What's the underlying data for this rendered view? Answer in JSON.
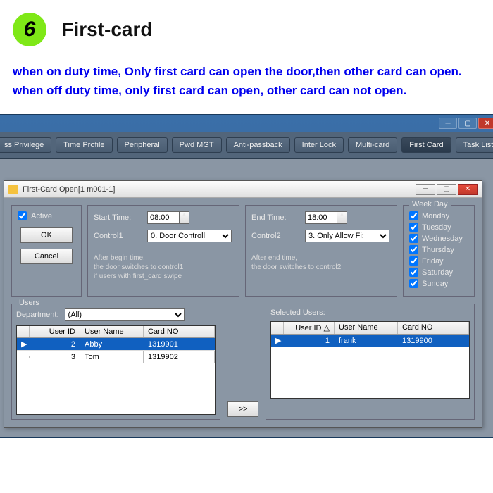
{
  "header": {
    "num": "6",
    "title": "First-card"
  },
  "desc": {
    "line1": "when on duty time, Only first card can open the door,then other card can open.",
    "line2": "when off duty time, only first card can open, other card can not open."
  },
  "tabs": [
    "ss Privilege",
    "Time Profile",
    "Peripheral",
    "Pwd MGT",
    "Anti-passback",
    "Inter Lock",
    "Multi-card",
    "First Card",
    "Task List"
  ],
  "tabs_active_index": 7,
  "dialog": {
    "title": "First-Card Open[1   m001-1]",
    "active_label": "Active",
    "ok": "OK",
    "cancel": "Cancel",
    "start_label": "Start Time:",
    "start_value": "08:00",
    "control1_label": "Control1",
    "control1_value": "0. Door Controll",
    "hint1a": "After begin time,",
    "hint1b": "the door switches to control1",
    "hint1c": "if users with first_card  swipe",
    "end_label": "End Time:",
    "end_value": "18:00",
    "control2_label": "Control2",
    "control2_value": "3. Only Allow Fi:",
    "hint2a": "After end time,",
    "hint2b": "the door switches to control2",
    "week_legend": "Week Day",
    "weekdays": [
      "Monday",
      "Tuesday",
      "Wednesday",
      "Thursday",
      "Friday",
      "Saturday",
      "Sunday"
    ]
  },
  "users": {
    "legend": "Users",
    "dept_label": "Department:",
    "dept_value": "(All)",
    "cols": [
      "",
      "User ID",
      "User Name",
      "Card NO"
    ],
    "rows": [
      {
        "id": "2",
        "name": "Abby",
        "card": "1319901",
        "sel": true
      },
      {
        "id": "3",
        "name": "Tom",
        "card": "1319902",
        "sel": false
      }
    ],
    "sel_label": "Selected Users:",
    "sel_cols": [
      "",
      "User ID   △",
      "User Name",
      "Card NO"
    ],
    "sel_rows": [
      {
        "id": "1",
        "name": "frank",
        "card": "1319900",
        "sel": true
      }
    ],
    "move_right": ">>"
  }
}
